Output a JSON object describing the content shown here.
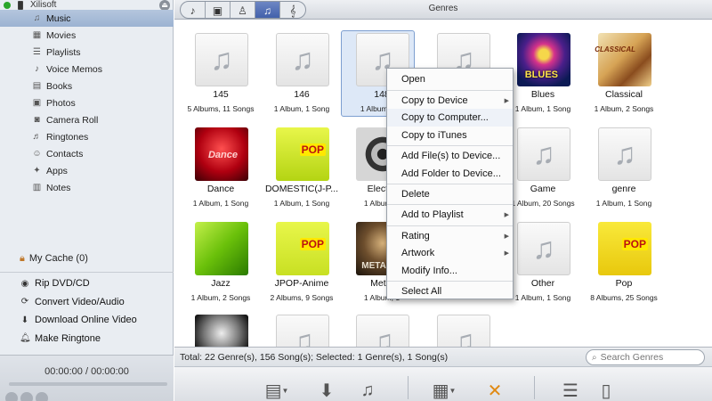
{
  "device": {
    "name": "Xilisoft"
  },
  "sidebar": {
    "items": [
      {
        "label": "Music",
        "icon": "music-note-icon"
      },
      {
        "label": "Movies",
        "icon": "movie-icon"
      },
      {
        "label": "Playlists",
        "icon": "playlist-icon"
      },
      {
        "label": "Voice Memos",
        "icon": "microphone-icon"
      },
      {
        "label": "Books",
        "icon": "book-icon"
      },
      {
        "label": "Photos",
        "icon": "photo-icon"
      },
      {
        "label": "Camera Roll",
        "icon": "camera-icon"
      },
      {
        "label": "Ringtones",
        "icon": "bell-icon"
      },
      {
        "label": "Contacts",
        "icon": "contacts-icon"
      },
      {
        "label": "Apps",
        "icon": "apps-icon"
      },
      {
        "label": "Notes",
        "icon": "notes-icon"
      }
    ],
    "cache": "My Cache (0)",
    "tools": [
      {
        "label": "Rip DVD/CD",
        "icon": "disc-icon"
      },
      {
        "label": "Convert Video/Audio",
        "icon": "convert-icon"
      },
      {
        "label": "Download Online Video",
        "icon": "download-icon"
      },
      {
        "label": "Make Ringtone",
        "icon": "bell-icon"
      }
    ],
    "player_time": "00:00:00 / 00:00:00"
  },
  "header": {
    "title": "Genres"
  },
  "tiles": [
    {
      "name": "145",
      "sub": "5 Albums, 11 Songs",
      "art": "note"
    },
    {
      "name": "146",
      "sub": "1 Album, 1 Song",
      "art": "note"
    },
    {
      "name": "148",
      "sub": "1 Album, 1 S",
      "art": "note"
    },
    {
      "name": "",
      "sub": "",
      "art": "note"
    },
    {
      "name": "Blues",
      "sub": "1 Album, 1 Song",
      "art": "blues",
      "badge": "BLUES"
    },
    {
      "name": "Classical",
      "sub": "1 Album, 2 Songs",
      "art": "classical",
      "badge": "CLASSICAL"
    },
    {
      "name": "Dance",
      "sub": "1 Album, 1 Song",
      "art": "dance",
      "badge": "Dance"
    },
    {
      "name": "DOMESTIC(J-P...",
      "sub": "1 Album, 1 Song",
      "art": "domestic",
      "badge": "POP"
    },
    {
      "name": "Electro",
      "sub": "1 Album, 2",
      "art": "electro"
    },
    {
      "name": "",
      "sub": "",
      "art": "note"
    },
    {
      "name": "Game",
      "sub": "1 Album, 20 Songs",
      "art": "note"
    },
    {
      "name": "genre",
      "sub": "1 Album, 1 Song",
      "art": "note"
    },
    {
      "name": "Jazz",
      "sub": "1 Album, 2 Songs",
      "art": "jazz"
    },
    {
      "name": "JPOP-Anime",
      "sub": "2 Albums, 9 Songs",
      "art": "jpop",
      "badge": "POP"
    },
    {
      "name": "Metal",
      "sub": "1 Album, 1",
      "art": "metal",
      "badge": "METAL"
    },
    {
      "name": "",
      "sub": "",
      "art": "note"
    },
    {
      "name": "Other",
      "sub": "1 Album, 1 Song",
      "art": "note"
    },
    {
      "name": "Pop",
      "sub": "8 Albums, 25 Songs",
      "art": "pop",
      "badge": "POP"
    },
    {
      "name": "",
      "sub": "",
      "art": "mic"
    },
    {
      "name": "",
      "sub": "",
      "art": "note"
    },
    {
      "name": "",
      "sub": "",
      "art": "note"
    },
    {
      "name": "",
      "sub": "",
      "art": "note"
    }
  ],
  "status": {
    "text": "Total: 22 Genre(s), 156 Song(s); Selected: 1 Genre(s), 1 Song(s)",
    "search_placeholder": "Search Genres"
  },
  "context_menu": {
    "items": [
      {
        "label": "Open",
        "submenu": false
      },
      {
        "label": "Copy to Device",
        "submenu": true
      },
      {
        "label": "Copy to Computer...",
        "submenu": false
      },
      {
        "label": "Copy to iTunes",
        "submenu": false
      },
      {
        "label": "Add File(s) to Device...",
        "submenu": false
      },
      {
        "label": "Add Folder to Device...",
        "submenu": false
      },
      {
        "label": "Delete",
        "submenu": false
      },
      {
        "label": "Add to Playlist",
        "submenu": true
      },
      {
        "label": "Rating",
        "submenu": true
      },
      {
        "label": "Artwork",
        "submenu": true
      },
      {
        "label": "Modify Info...",
        "submenu": false
      },
      {
        "label": "Select All",
        "submenu": false
      }
    ]
  },
  "colors": {
    "selection": "#dde8f7",
    "active_tab": "#3d5da8",
    "sidebar_bg": "#e9edf2"
  }
}
